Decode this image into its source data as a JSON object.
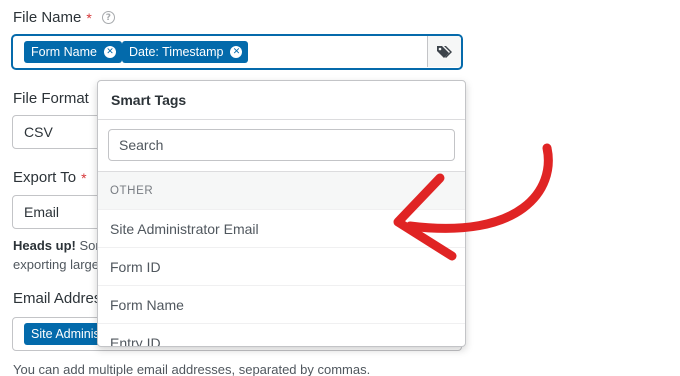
{
  "form": {
    "file_name": {
      "label": "File Name",
      "required_mark": "*",
      "chips": [
        {
          "label": "Form Name"
        },
        {
          "label": "Date: Timestamp"
        }
      ]
    },
    "file_format": {
      "label": "File Format",
      "value": "CSV"
    },
    "export_to": {
      "label": "Export To",
      "required_mark": "*",
      "value": "Email",
      "notice_bold": "Heads up!",
      "notice_line1": "Som",
      "notice_line2": "exporting large"
    },
    "email_address": {
      "label": "Email Address",
      "chip": "Site Adminis",
      "hint": "You can add multiple email addresses, separated by commas."
    }
  },
  "smart_tags": {
    "title": "Smart Tags",
    "search_placeholder": "Search",
    "group_label": "OTHER",
    "items": [
      {
        "label": "Site Administrator Email"
      },
      {
        "label": "Form ID"
      },
      {
        "label": "Form Name"
      },
      {
        "label": "Entry ID"
      }
    ]
  },
  "colors": {
    "accent": "#036aab",
    "required": "#d63638",
    "annotation_arrow": "#e02424"
  },
  "icons": {
    "help": "question-circle-icon",
    "chip_remove": "x-circle-icon",
    "smart_tags_button": "tags-icon"
  }
}
